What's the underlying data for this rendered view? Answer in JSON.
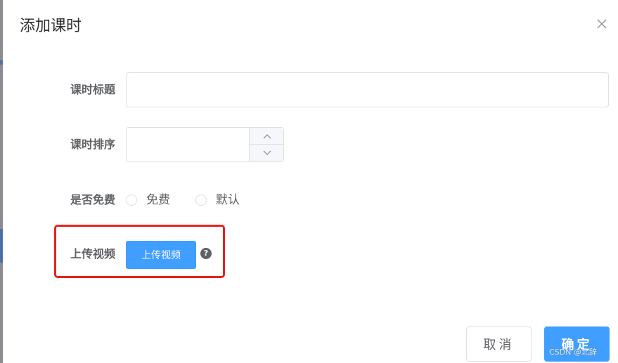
{
  "dialog": {
    "title": "添加课时",
    "close_icon": "close-icon"
  },
  "form": {
    "title_field": {
      "label": "课时标题",
      "value": "",
      "placeholder": ""
    },
    "sort_field": {
      "label": "课时排序",
      "value": "",
      "up_icon": "chevron-up-icon",
      "down_icon": "chevron-down-icon"
    },
    "free_field": {
      "label": "是否免费",
      "options": [
        "免费",
        "默认"
      ],
      "selected": null
    },
    "video_field": {
      "label": "上传视频",
      "button_label": "上传视频",
      "help_icon": "question-circle-icon",
      "help_glyph": "?",
      "highlight_color": "#e8231b"
    }
  },
  "footer": {
    "cancel_label": "取消",
    "confirm_label": "确定"
  },
  "watermark": "CSDN @北辞",
  "colors": {
    "primary": "#409eff",
    "border": "#dcdfe6",
    "text": "#606266",
    "title": "#303133",
    "highlight": "#e8231b"
  }
}
